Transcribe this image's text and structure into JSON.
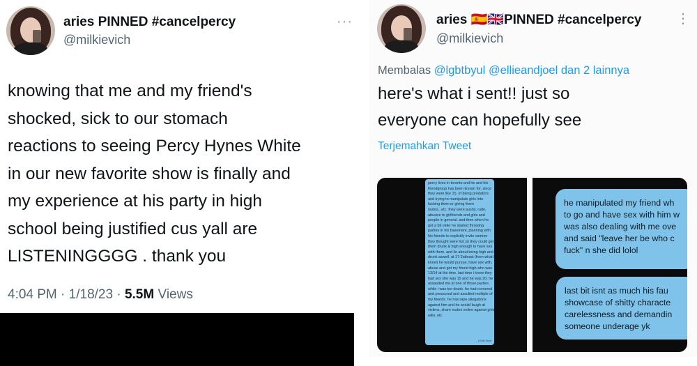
{
  "left_tweet": {
    "author_name": "aries PINNED #cancelpercy",
    "author_handle": "@milkievich",
    "more": "···",
    "text_lines": [
      "knowing that me and my friend's",
      "shocked, sick to our stomach",
      "reactions to seeing Percy Hynes White",
      "in our new favorite show is finally and",
      "my experience at his party in high",
      "school being justified cus yall are",
      "LISTENINGGGG . thank you"
    ],
    "time": "4:04 PM",
    "date": "1/18/23",
    "views_count": "5.5M",
    "views_label": "Views",
    "separator": "·"
  },
  "right_tweet": {
    "author_name": "aries 🇪🇸🇬🇧PINNED #cancelpercy",
    "author_handle": "@milkievich",
    "more": "⋮",
    "reply_prefix": "Membalas",
    "reply_user1": "@lgbtbyul",
    "reply_user2": "@ellieandjoel",
    "reply_suffix": "dan 2 lainnya",
    "text_lines": [
      "here's what i sent!! just so",
      "everyone can hopefully see"
    ],
    "translate_label": "Terjemahkan Tweet",
    "image1_message_lines": [
      "percy lives in toronto and he and his",
      "friendgroup has been known for, since",
      "they were like 15, of being predators",
      "and trying to manipulate girls into",
      "fucking them or giving them",
      "nudes...etc. they were pushy, rude,",
      "abusive to girlfriends and girls and",
      "people in general. and then when he",
      "got a bit older he started throwing",
      "parties in his basement, planning with",
      "his friends to explicitly invite women",
      "they thought were hot so they could get",
      "them drunk & high enough to have sex",
      "with them. and lie about being high and",
      "drunk aswell. at 17-2atleast (from what I",
      "know) he would pursue, have sex with,",
      "abuse and get my friend high who was",
      "13/14 at the time. last time i knew they",
      "had sex she was 15 and he was 20. he",
      "assaulted me at one of those parties",
      "while i was too drunk. he had cornered",
      "and pressured and assulted multiple of",
      "my friends. he has rape allegations",
      "against him and he would laugh at",
      "victims, share nudes online against girls",
      "wills. etc"
    ],
    "image1_time": "19:56 Sent",
    "image2_bubble1_lines": [
      "he manipulated my friend wh",
      "to go and have sex with him w",
      "was also dealing with me ove",
      "and said \"leave her be who c",
      "fuck\" n she did lolol"
    ],
    "image2_bubble2_lines": [
      "last bit isnt as much his fau",
      "showcase of shitty characte",
      "carelessness and demandin",
      "someone underage yk"
    ]
  },
  "colors": {
    "link": "#1d9bf0",
    "secondary_text": "#536471",
    "bubble": "#7fc3ea"
  }
}
